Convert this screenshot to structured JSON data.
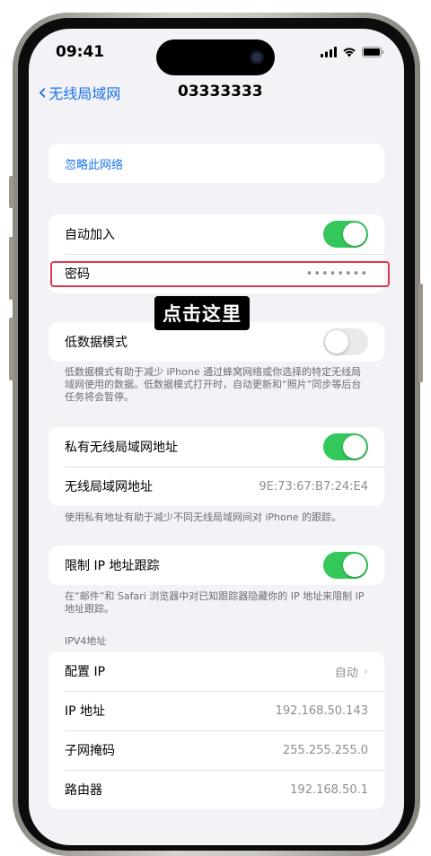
{
  "status": {
    "time": "09:41"
  },
  "nav": {
    "back_label": "无线局域网",
    "title": "03333333"
  },
  "forget": {
    "label": "忽略此网络"
  },
  "auto_join": {
    "label": "自动加入",
    "on": true
  },
  "password": {
    "label": "密码",
    "value": "••••••••"
  },
  "callout": {
    "text": "点击这里"
  },
  "low_data": {
    "label": "低数据模式",
    "on": false,
    "footnote": "低数据模式有助于减少 iPhone 通过蜂窝网络或你选择的特定无线局域网使用的数据。低数据模式打开时，自动更新和“照片”同步等后台任务将会暂停。"
  },
  "private_addr": {
    "label": "私有无线局域网地址",
    "on": true,
    "wlan_label": "无线局域网地址",
    "wlan_value": "9E:73:67:B7:24:E4",
    "footnote": "使用私有地址有助于减少不同无线局域网间对 iPhone 的跟踪。"
  },
  "limit_ip": {
    "label": "限制 IP 地址跟踪",
    "on": true,
    "footnote": "在“邮件”和 Safari 浏览器中对已知跟踪器隐藏你的 IP 地址来限制 IP 地址跟踪。"
  },
  "ipv4": {
    "header": "IPV4地址",
    "rows": [
      {
        "label": "配置 IP",
        "value": "自动"
      },
      {
        "label": "IP 地址",
        "value": "192.168.50.143"
      },
      {
        "label": "子网掩码",
        "value": "255.255.255.0"
      },
      {
        "label": "路由器",
        "value": "192.168.50.1"
      }
    ]
  },
  "colors": {
    "accent": "#1a73e8",
    "toggle_on": "#34c759",
    "highlight": "#e0394f"
  }
}
